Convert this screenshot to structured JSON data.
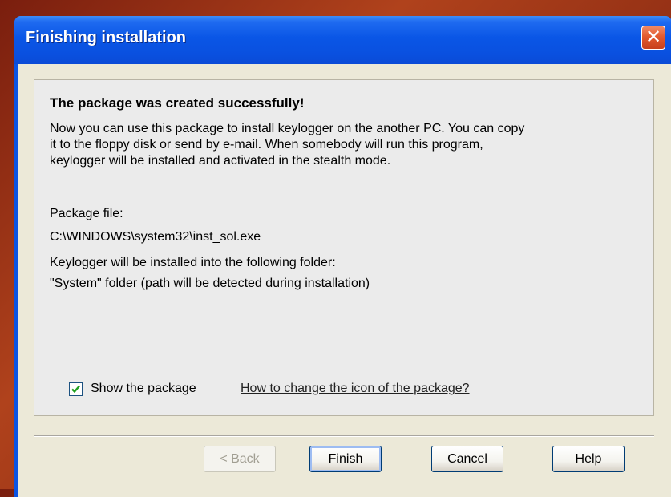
{
  "window": {
    "title": "Finishing installation",
    "close_symbol": "✕"
  },
  "content": {
    "heading": "The package was created successfully!",
    "description": "Now you can use this package to install keylogger on the another PC. You can copy it to the floppy disk or send by e-mail. When somebody will run this program, keylogger will be installed and activated in the stealth mode.",
    "package_file_label": "Package file:",
    "package_file_path": "C:\\WINDOWS\\system32\\inst_sol.exe",
    "install_folder_label": "Keylogger will be installed into the following folder:",
    "install_folder_value": "\"System\" folder (path will be detected during installation)"
  },
  "options": {
    "show_package_label": "Show the package",
    "show_package_checked": true,
    "icon_help_link": "How to change the icon of the package?"
  },
  "buttons": {
    "back": "< Back",
    "finish": "Finish",
    "cancel": "Cancel",
    "help": "Help"
  },
  "colors": {
    "titlebar": "#0a56e6",
    "close_button": "#e25a2e",
    "client_background": "#ece9d8",
    "panel_background": "#ebebeb",
    "checkmark": "#21a121"
  }
}
